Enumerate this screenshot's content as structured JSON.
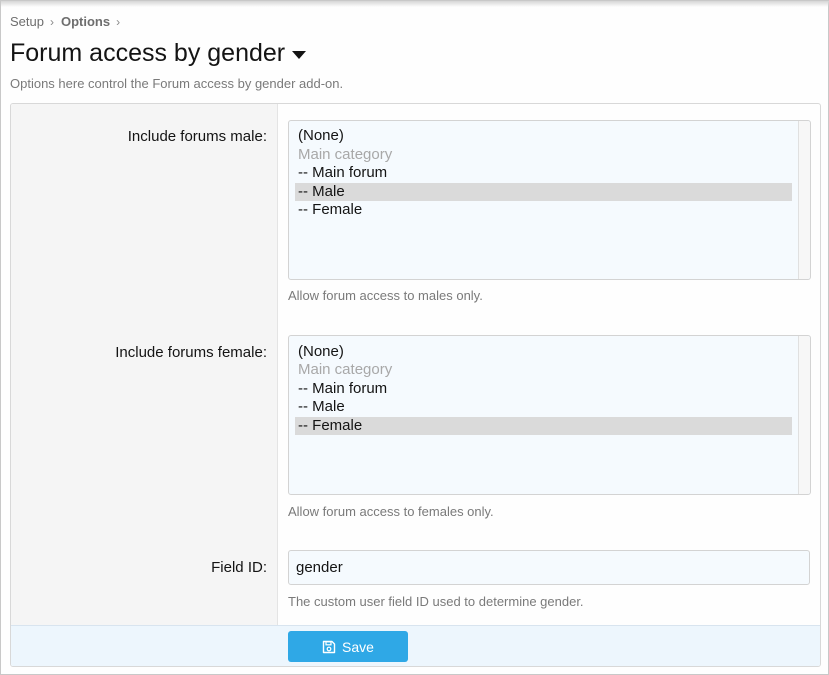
{
  "breadcrumb": {
    "items": [
      {
        "label": "Setup"
      },
      {
        "label": "Options"
      }
    ]
  },
  "header": {
    "title": "Forum access by gender",
    "description": "Options here control the Forum access by gender add-on."
  },
  "fields": {
    "include_male": {
      "label": "Include forums male:",
      "options": [
        "(None)",
        "Main category",
        "-- Main forum",
        "-- Male",
        "-- Female"
      ],
      "selected": "-- Male",
      "hint": "Allow forum access to males only."
    },
    "include_female": {
      "label": "Include forums female:",
      "options": [
        "(None)",
        "Main category",
        "-- Main forum",
        "-- Male",
        "-- Female"
      ],
      "selected": "-- Female",
      "hint": "Allow forum access to females only."
    },
    "field_id": {
      "label": "Field ID:",
      "value": "gender",
      "hint": "The custom user field ID used to determine gender."
    }
  },
  "footer": {
    "save_label": "Save"
  },
  "icons": {
    "breadcrumb_separator": "chevron-right-icon",
    "title_menu": "caret-down-icon",
    "save": "floppy-disk-icon"
  },
  "colors": {
    "accent": "#2fa8e6",
    "footer_bg": "#edf6fd",
    "selected_option": "#dadada"
  }
}
